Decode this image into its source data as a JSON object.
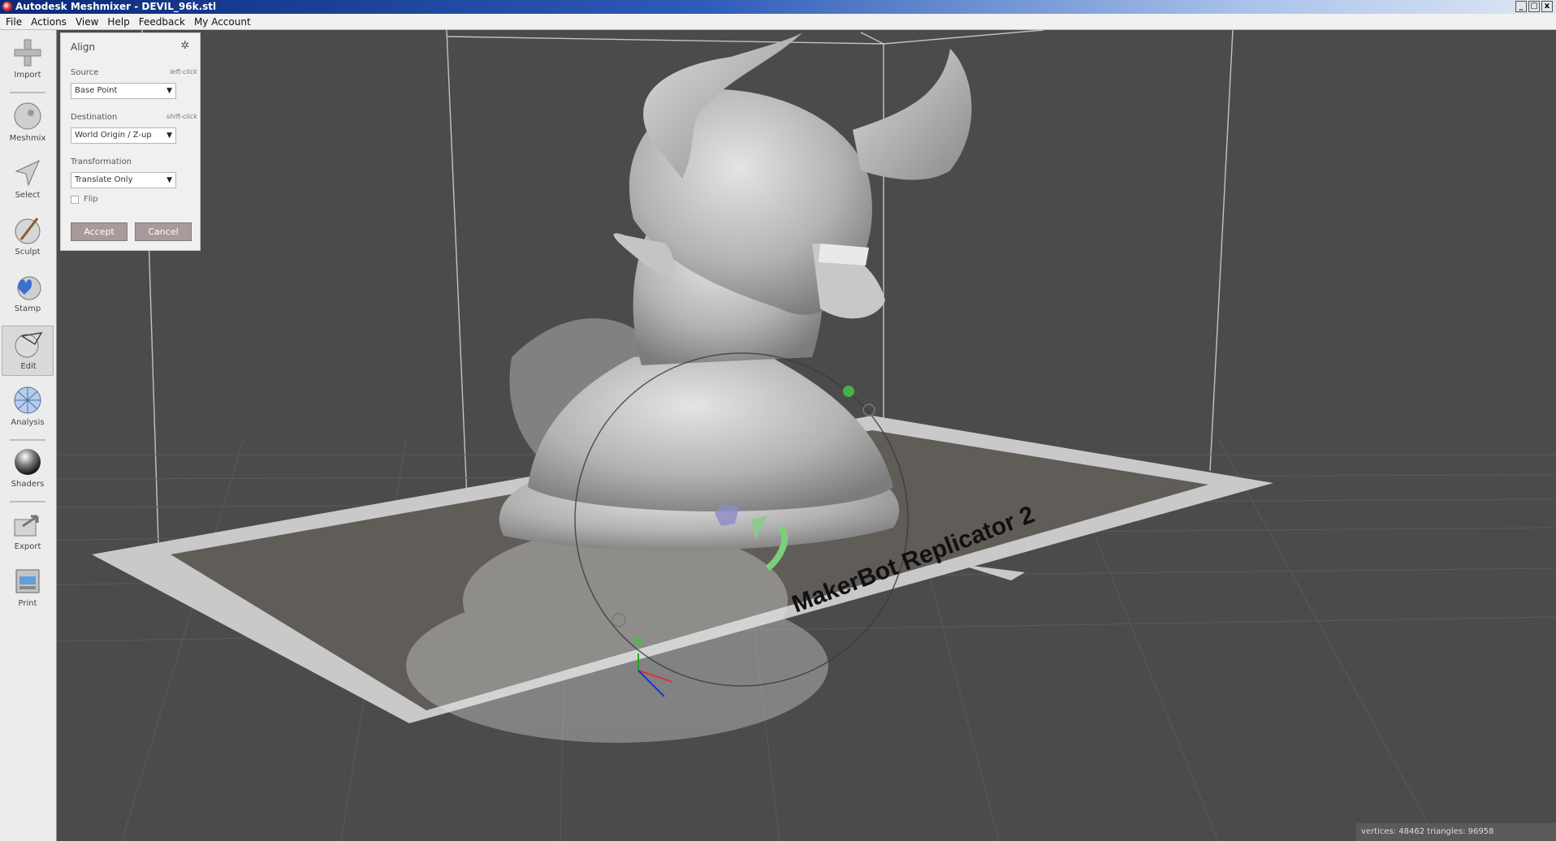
{
  "window": {
    "title": "Autodesk Meshmixer - DEVIL_96k.stl",
    "buttons": [
      "_",
      "▢",
      "x"
    ]
  },
  "menu": [
    "File",
    "Actions",
    "View",
    "Help",
    "Feedback",
    "My Account"
  ],
  "sidebar": {
    "tools": [
      {
        "label": "Import",
        "icon": "plus-icon"
      },
      {
        "label": "Meshmix",
        "icon": "meshmix-icon"
      },
      {
        "label": "Select",
        "icon": "select-arrow-icon"
      },
      {
        "label": "Sculpt",
        "icon": "brush-icon"
      },
      {
        "label": "Stamp",
        "icon": "stamp-icon"
      },
      {
        "label": "Edit",
        "icon": "edit-icon",
        "active": true
      },
      {
        "label": "Analysis",
        "icon": "analysis-icon"
      },
      {
        "label": "Shaders",
        "icon": "sphere-icon"
      },
      {
        "label": "Export",
        "icon": "export-icon"
      },
      {
        "label": "Print",
        "icon": "printer-icon"
      }
    ]
  },
  "align_panel": {
    "title": "Align",
    "source_label": "Source",
    "source_hint": "left-click",
    "source_value": "Base Point",
    "destination_label": "Destination",
    "destination_hint": "shift-click",
    "destination_value": "World Origin / Z-up",
    "transformation_label": "Transformation",
    "transformation_value": "Translate Only",
    "flip_label": "Flip",
    "flip_checked": false,
    "accept_label": "Accept",
    "cancel_label": "Cancel"
  },
  "scene": {
    "printer_label": "MakerBot Replicator 2"
  },
  "status": {
    "text": "vertices: 48462 triangles: 96958"
  },
  "colors": {
    "background": "#4b4b4b",
    "plate_frame": "#c8c8c8",
    "model": "#bdbdbd",
    "accent_button": "#a89a9a"
  }
}
